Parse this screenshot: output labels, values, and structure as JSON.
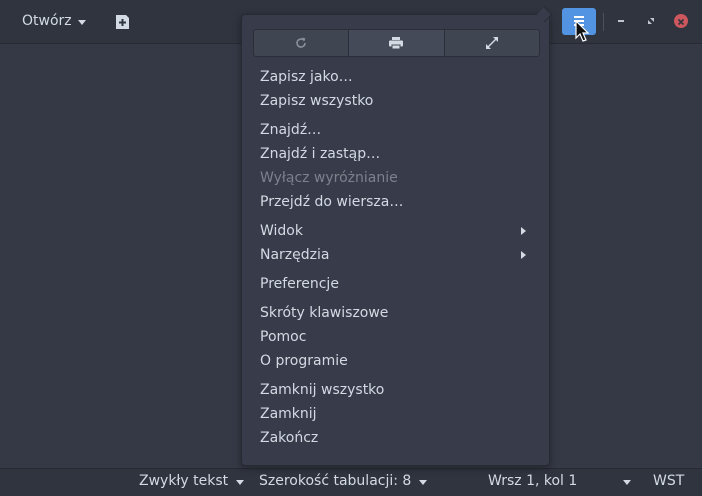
{
  "header": {
    "open_label": "Otwórz",
    "icons": [
      "new-document-icon",
      "hamburger-menu-icon",
      "minimize-icon",
      "maximize-icon",
      "close-icon"
    ],
    "accent_color": "#5294e2"
  },
  "menu": {
    "toolbar_icons": [
      "reload-icon",
      "print-icon",
      "fullscreen-icon"
    ],
    "items": [
      {
        "label": "Zapisz jako…"
      },
      {
        "label": "Zapisz wszystko"
      },
      {
        "label": "Znajdź…"
      },
      {
        "label": "Znajdź i zastąp…"
      },
      {
        "label": "Wyłącz wyróżnianie",
        "disabled": true
      },
      {
        "label": "Przejdź do wiersza…"
      },
      {
        "label": "Widok",
        "submenu": true
      },
      {
        "label": "Narzędzia",
        "submenu": true
      },
      {
        "label": "Preferencje"
      },
      {
        "label": "Skróty klawiszowe"
      },
      {
        "label": "Pomoc"
      },
      {
        "label": "O programie"
      },
      {
        "label": "Zamknij wszystko"
      },
      {
        "label": "Zamknij"
      },
      {
        "label": "Zakończ"
      }
    ]
  },
  "statusbar": {
    "language": "Zwykły tekst",
    "tab_width": "Szerokość tabulacji: 8",
    "position": "Wrsz 1, kol 1",
    "insert_mode": "WST"
  }
}
